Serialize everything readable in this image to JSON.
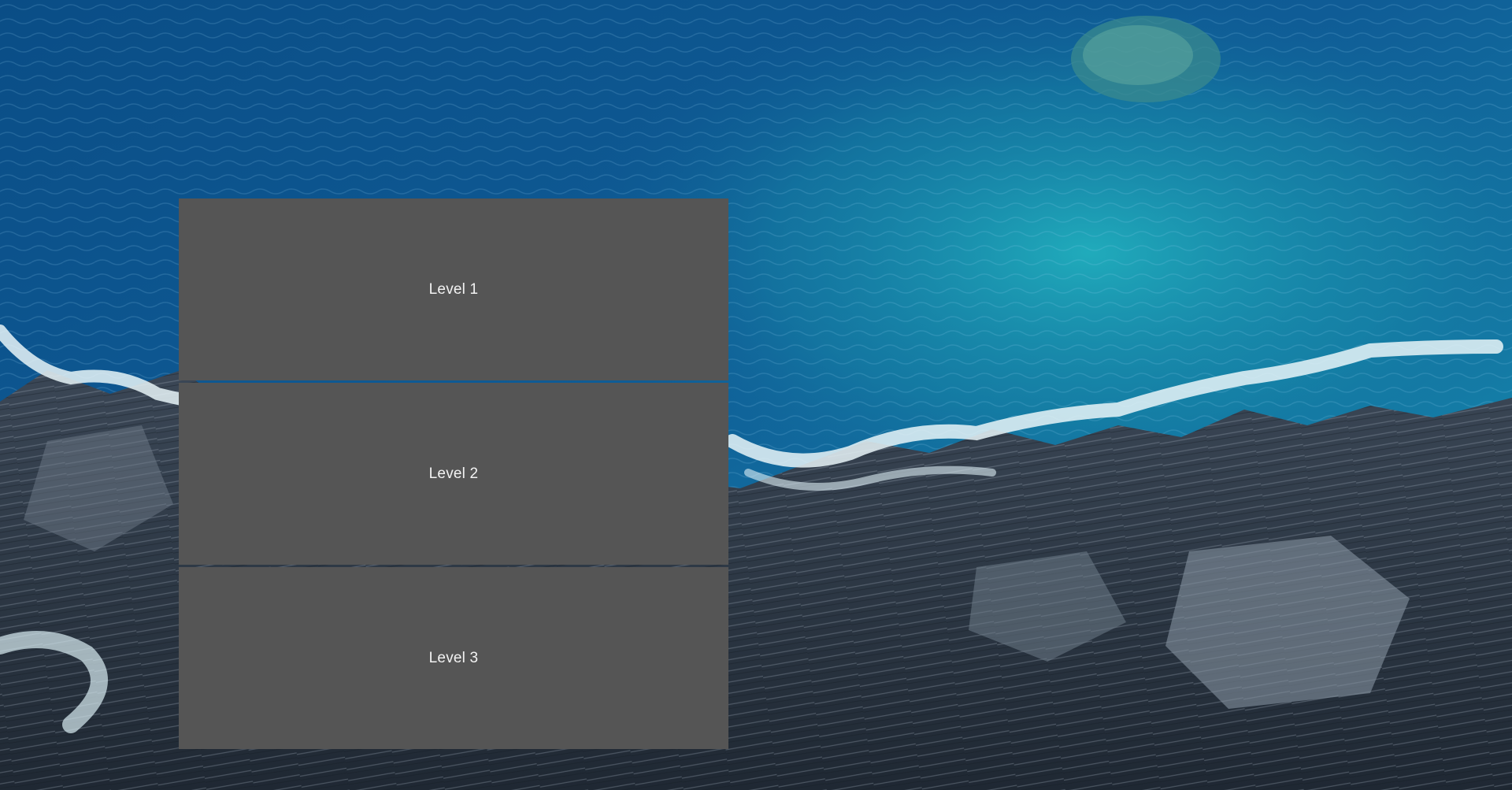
{
  "background": {
    "scene": "aerial-ocean-and-rocky-coast",
    "colors": {
      "deep_ocean": "#0b3f73",
      "ocean": "#0f5b93",
      "turquoise": "#1aa3b5",
      "foam": "#e8f4f8",
      "rock_dark": "#2f3a47",
      "rock_light": "#8592a0"
    }
  },
  "menu": {
    "button_color": "#555555",
    "text_color": "#f3f3f3",
    "levels": [
      {
        "label": "Level 1"
      },
      {
        "label": "Level 2"
      },
      {
        "label": "Level 3"
      }
    ]
  }
}
